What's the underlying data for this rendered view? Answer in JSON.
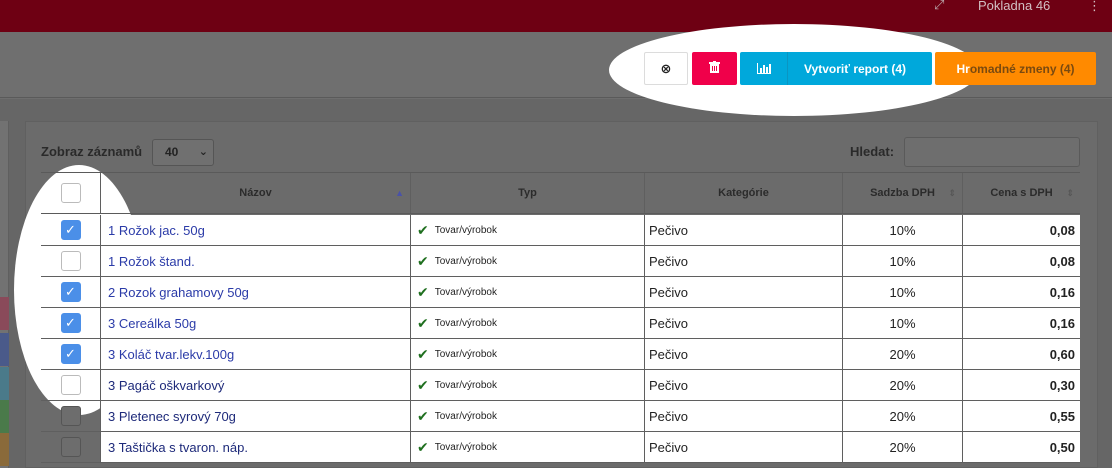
{
  "header": {
    "title": "Pokladna 46",
    "expand_icon": "expand-icon",
    "menu_icon": "kebab-icon"
  },
  "toolbar": {
    "close_icon": "⊗",
    "delete_icon": "🗑",
    "report_icon": "bar-chart-icon",
    "report_label": "Vytvoriť report (4)",
    "bulk_label_a": "Hr",
    "bulk_label_b": "omadné zmeny (4)",
    "colors": {
      "delete": "#f0004a",
      "report": "#00a8db",
      "bulk": "#ff8a00"
    }
  },
  "controls": {
    "show_label": "Zobraz záznamů",
    "show_value": "40",
    "search_label": "Hledat:",
    "search_value": ""
  },
  "table": {
    "columns": [
      "Názov",
      "Typ",
      "Kategórie",
      "Sadzba DPH",
      "Cena s DPH"
    ],
    "rows": [
      {
        "checked": true,
        "name": "1 Rožok jac. 50g",
        "typ": "Tovar/výrobok",
        "kat": "Pečivo",
        "dph": "10%",
        "price": "0,08"
      },
      {
        "checked": false,
        "name": "1 Rožok štand.",
        "typ": "Tovar/výrobok",
        "kat": "Pečivo",
        "dph": "10%",
        "price": "0,08"
      },
      {
        "checked": true,
        "name": "2 Rozok grahamovy 50g",
        "typ": "Tovar/výrobok",
        "kat": "Pečivo",
        "dph": "10%",
        "price": "0,16"
      },
      {
        "checked": true,
        "name": "3 Cereálka 50g",
        "typ": "Tovar/výrobok",
        "kat": "Pečivo",
        "dph": "10%",
        "price": "0,16"
      },
      {
        "checked": true,
        "name": "3 Koláč tvar.lekv.100g",
        "typ": "Tovar/výrobok",
        "kat": "Pečivo",
        "dph": "20%",
        "price": "0,60"
      },
      {
        "checked": false,
        "name": "3 Pagáč oškvarkový",
        "typ": "Tovar/výrobok",
        "kat": "Pečivo",
        "dph": "20%",
        "price": "0,30"
      },
      {
        "checked": false,
        "name": "3 Pletenec syrový 70g",
        "typ": "Tovar/výrobok",
        "kat": "Pečivo",
        "dph": "20%",
        "price": "0,55"
      },
      {
        "checked": false,
        "name": "3 Taštička s tvaron. náp.",
        "typ": "Tovar/výrobok",
        "kat": "Pečivo",
        "dph": "20%",
        "price": "0,50"
      }
    ]
  }
}
